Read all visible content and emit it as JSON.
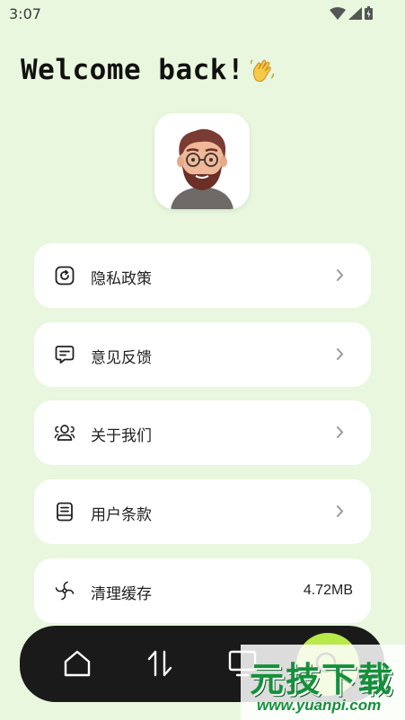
{
  "status_bar": {
    "time": "3:07"
  },
  "header": {
    "title": "Welcome back!"
  },
  "menu": {
    "items": [
      {
        "icon": "refresh-icon",
        "label": "隐私政策"
      },
      {
        "icon": "message-icon",
        "label": "意见反馈"
      },
      {
        "icon": "users-icon",
        "label": "关于我们"
      },
      {
        "icon": "document-icon",
        "label": "用户条款"
      },
      {
        "icon": "fan-icon",
        "label": "清理缓存",
        "value": "4.72MB"
      }
    ]
  },
  "bottom_nav": {
    "items": [
      {
        "icon": "home-icon"
      },
      {
        "icon": "transfer-icon"
      },
      {
        "icon": "monitor-icon"
      },
      {
        "icon": "search-icon",
        "active": true
      }
    ],
    "active_color": "#b7e94b"
  },
  "watermark": {
    "title": "元技下载",
    "url": "www.yuanpi.com"
  },
  "colors": {
    "background": "#e8f7dd",
    "card": "#ffffff",
    "nav": "#1a1a1a",
    "accent": "#b7e94b"
  }
}
